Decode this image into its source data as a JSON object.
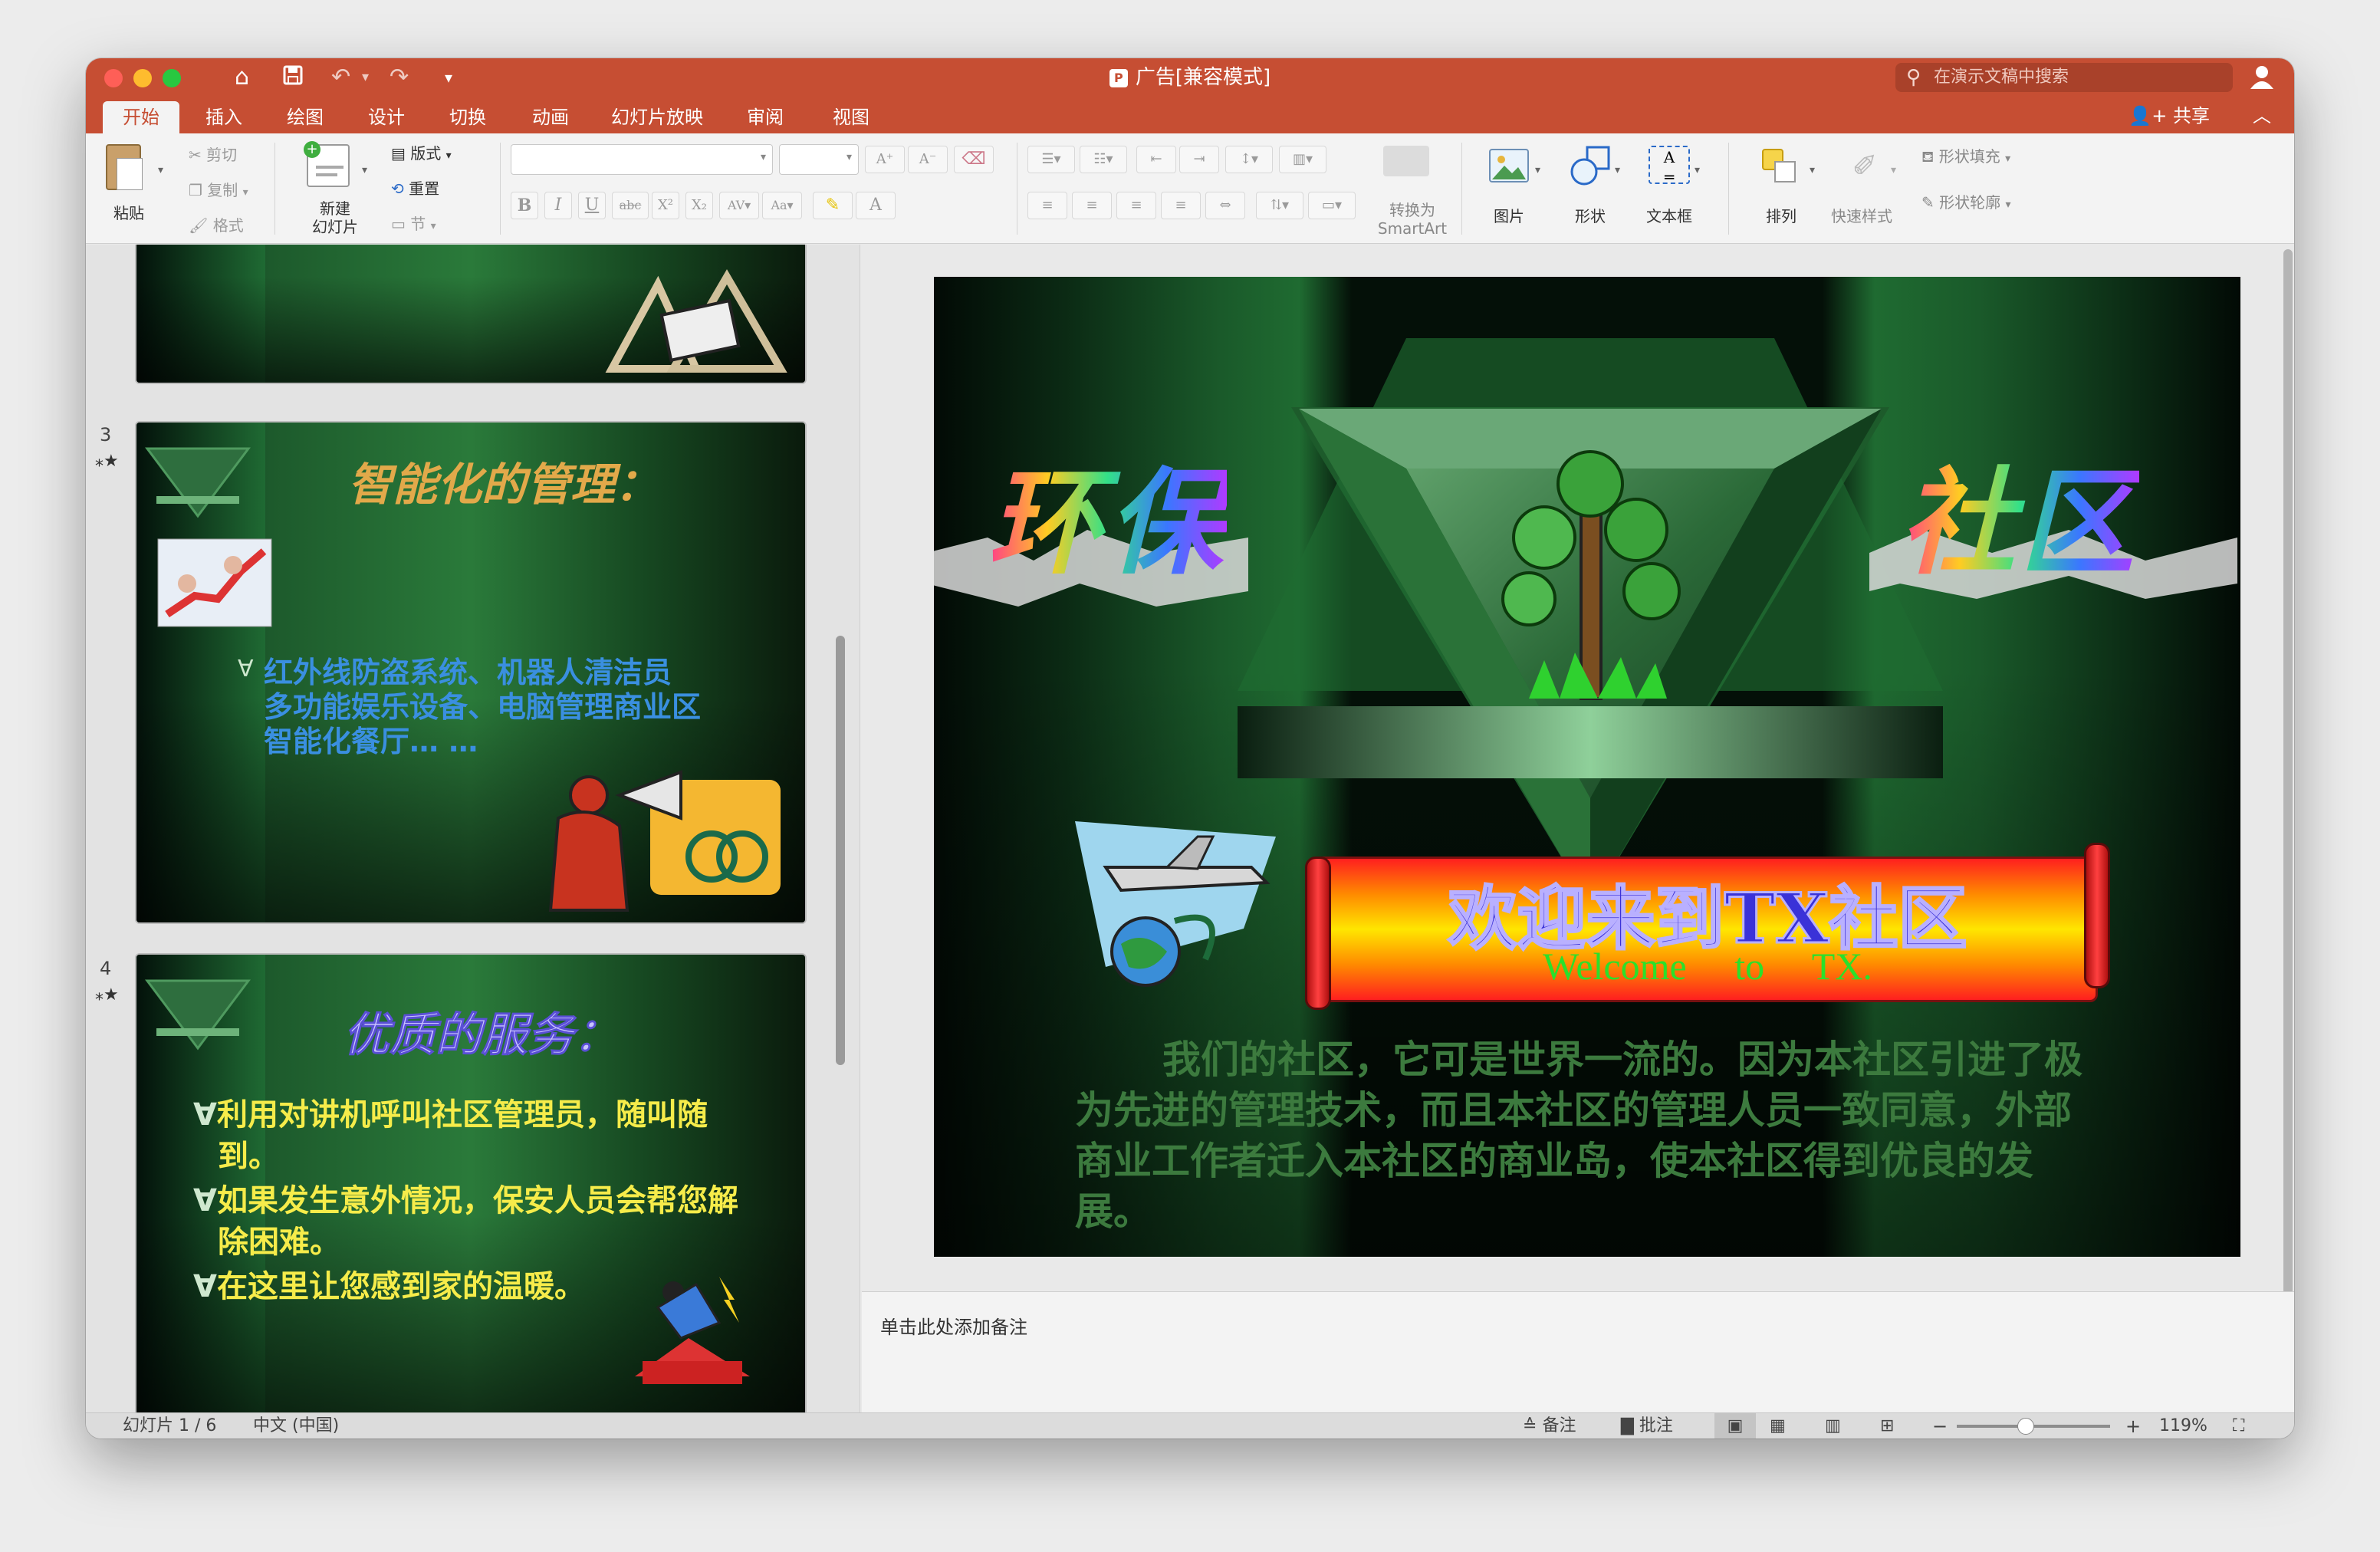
{
  "window": {
    "title": "广告[兼容模式]"
  },
  "quick_access": {
    "home": "⌂",
    "save": "💾",
    "undo": "↶",
    "redo": "↷",
    "more": "▾"
  },
  "search": {
    "placeholder": "在演示文稿中搜索"
  },
  "tabs": [
    "开始",
    "插入",
    "绘图",
    "设计",
    "切换",
    "动画",
    "幻灯片放映",
    "审阅",
    "视图"
  ],
  "active_tab": "开始",
  "share_label": "共享",
  "ribbon": {
    "paste": "粘贴",
    "cut": "剪切",
    "copy": "复制",
    "format": "格式",
    "new_slide_line1": "新建",
    "new_slide_line2": "幻灯片",
    "layout": "版式",
    "reset": "重置",
    "section": "节",
    "convert_line1": "转换为",
    "convert_line2": "SmartArt",
    "picture": "图片",
    "shape": "形状",
    "textbox": "文本框",
    "arrange": "排列",
    "quick_styles": "快速样式",
    "shape_fill": "形状填充",
    "shape_outline": "形状轮廓"
  },
  "thumbnails": {
    "slide3": {
      "number": "3",
      "title": "智能化的管理：",
      "bullets": [
        "红外线防盗系统、机器人清洁员",
        "多功能娱乐设备、电脑管理商业区",
        "智能化餐厅… …"
      ]
    },
    "slide4": {
      "number": "4",
      "title": "优质的服务：",
      "bullets": [
        "利用对讲机呼叫社区管理员，随叫随到。",
        "如果发生意外情况，保安人员会帮您解除困难。",
        "在这里让您感到家的温暖。"
      ]
    }
  },
  "slide": {
    "title_left": "环保",
    "title_right": "社区",
    "banner_title": "欢迎来到TX社区",
    "banner_sub": "Welcome to TX.",
    "body": "我们的社区，它可是世界一流的。因为本社区引进了极为先进的管理技术，而且本社区的管理人员一致同意，外部商业工作者迁入本社区的商业岛，使本社区得到优良的发展。"
  },
  "notes_placeholder": "单击此处添加备注",
  "status": {
    "slide_count": "幻灯片 1 / 6",
    "language": "中文 (中国)",
    "notes": "备注",
    "comments": "批注",
    "zoom_minus": "−",
    "zoom_plus": "+",
    "zoom": "119%",
    "zoom_level": 0.45
  },
  "colors": {
    "accent": "#c64e33"
  }
}
